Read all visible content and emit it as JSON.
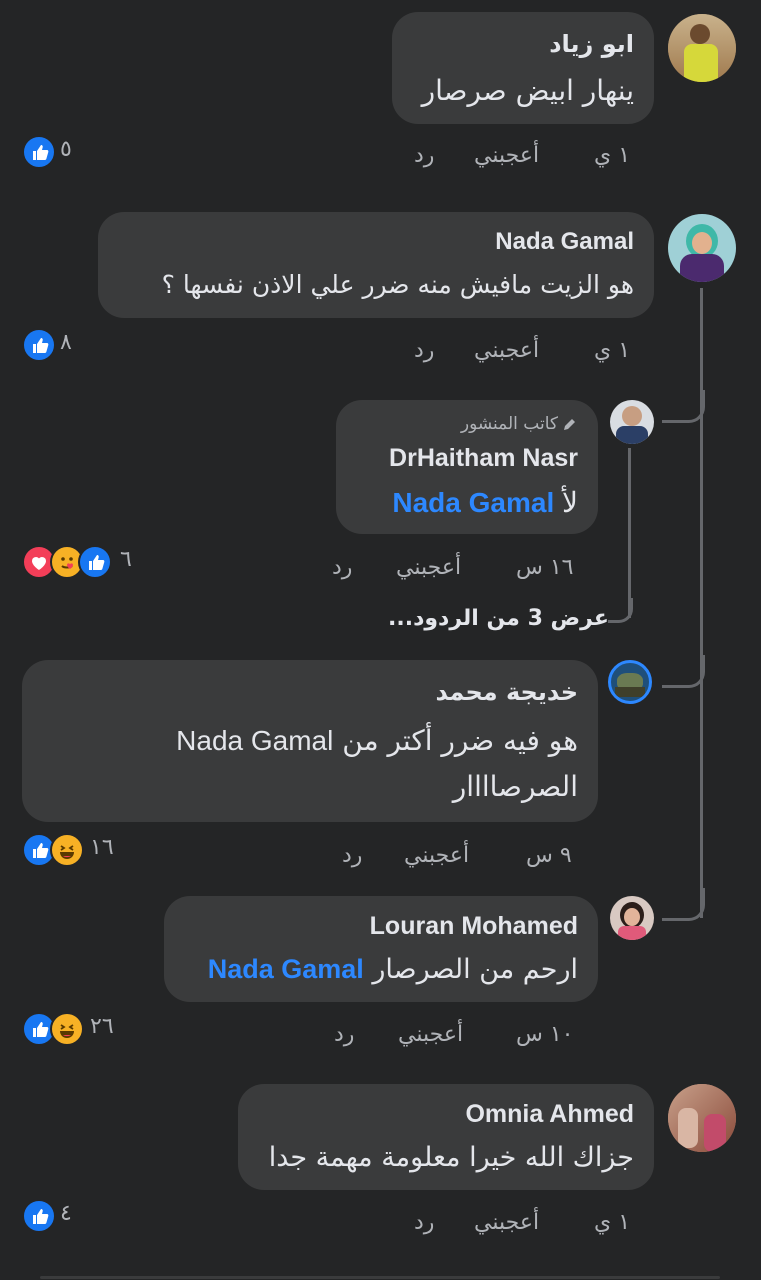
{
  "comments": [
    {
      "author": "ابو زياد",
      "lines": [
        "ينهار ابيض صرصار"
      ],
      "time": "١ ي",
      "like_label": "أعجبني",
      "reply_label": "رد",
      "reactions": [
        "like"
      ],
      "reaction_count": "٥"
    },
    {
      "author": "Nada Gamal",
      "lines": [
        "هو الزيت مافيش منه ضرر علي الاذن نفسها ؟"
      ],
      "time": "١ ي",
      "like_label": "أعجبني",
      "reply_label": "رد",
      "reactions": [
        "like"
      ],
      "reaction_count": "٨"
    },
    {
      "badge": "كاتب المنشور",
      "author": "DrHaitham Nasr",
      "mention": "Nada Gamal",
      "text_after_mention": "لأ",
      "time": "١٦ س",
      "like_label": "أعجبني",
      "reply_label": "رد",
      "reactions": [
        "like",
        "care",
        "heart"
      ],
      "reaction_count": "٦"
    },
    {
      "author": "خديجة محمد",
      "line1_prefix": "هو فيه ضرر أكتر من",
      "line1_name": "Nada Gamal",
      "line2": "الصرصاااار",
      "time": "٩ س",
      "like_label": "أعجبني",
      "reply_label": "رد",
      "reactions": [
        "haha",
        "like"
      ],
      "reaction_count": "١٦"
    },
    {
      "author": "Louran Mohamed",
      "mention": "Nada Gamal",
      "text_after_mention": "ارحم من الصرصار",
      "time": "١٠ س",
      "like_label": "أعجبني",
      "reply_label": "رد",
      "reactions": [
        "haha",
        "like"
      ],
      "reaction_count": "٢٦"
    },
    {
      "author": "Omnia Ahmed",
      "lines": [
        "جزاك الله خيرا معلومة مهمة جدا"
      ],
      "time": "١ ي",
      "like_label": "أعجبني",
      "reply_label": "رد",
      "reactions": [
        "like"
      ],
      "reaction_count": "٤"
    }
  ],
  "view_replies": "عرض 3 من الردود...",
  "colors": {
    "background": "#242526",
    "bubble": "#3a3b3c",
    "mention": "#2d88ff",
    "like": "#1877f2",
    "heart": "#f33e58",
    "haha": "#f7b125"
  }
}
